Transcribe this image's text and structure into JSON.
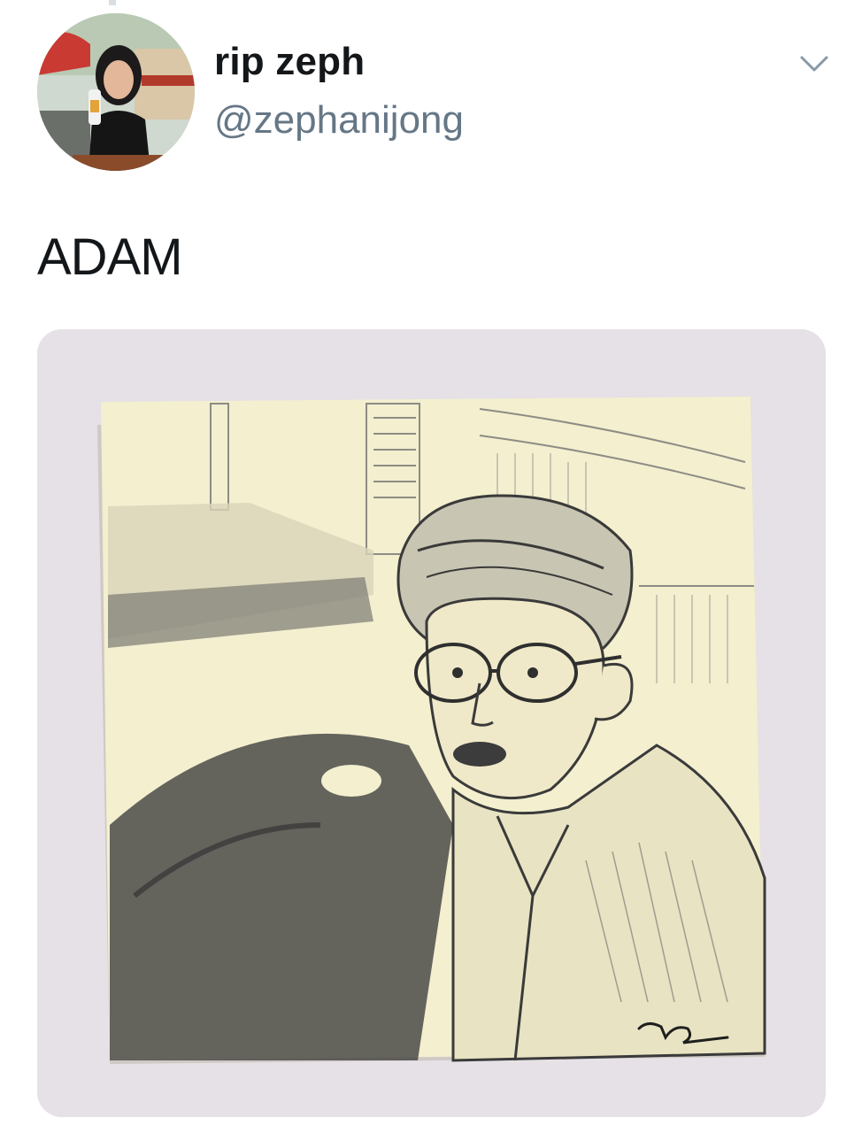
{
  "tweet": {
    "user": {
      "display_name": "rip zeph",
      "handle": "@zephanijong",
      "avatar_icon": "profile-photo"
    },
    "menu_icon": "chevron-down-icon",
    "text": "ADAM",
    "media": {
      "kind": "photo",
      "subject": "pencil sketch on sticky note",
      "colors": {
        "background": "#e6e1e6",
        "paper": "#f3efcf",
        "graphite": "#3a3a3a"
      }
    },
    "colors": {
      "name": "#14171a",
      "handle": "#657786",
      "chevron": "#8899a6"
    }
  }
}
